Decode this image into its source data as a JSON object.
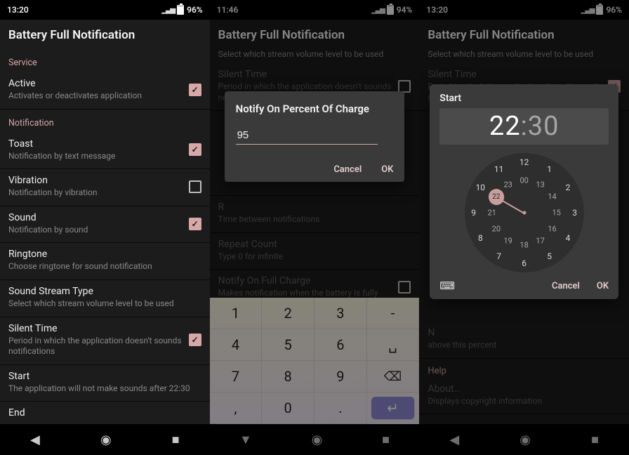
{
  "s1": {
    "time": "13:20",
    "batt": "96%",
    "title": "Battery Full Notification",
    "svc_label": "Service",
    "active": {
      "t": "Active",
      "s": "Activates or deactivates application"
    },
    "notif_label": "Notification",
    "toast": {
      "t": "Toast",
      "s": "Notification by text message"
    },
    "vibration": {
      "t": "Vibration",
      "s": "Notification by vibration"
    },
    "sound": {
      "t": "Sound",
      "s": "Notification by sound"
    },
    "ringtone": {
      "t": "Ringtone",
      "s": "Choose ringtone for sound notification"
    },
    "stream": {
      "t": "Sound Stream Type",
      "s": "Select which stream volume level to be used"
    },
    "silent": {
      "t": "Silent Time",
      "s": "Period in which the application doesn't sounds notifications"
    },
    "start": {
      "t": "Start",
      "s": "The application will not make sounds after 22:30"
    },
    "end": {
      "t": "End"
    }
  },
  "s2": {
    "time": "11:46",
    "batt": "94%",
    "title": "Battery Full Notification",
    "subtitle": "Select which stream volume level to be used",
    "silent": {
      "t": "Silent Time",
      "s": "Period in which the application doesn't sounds notifications"
    },
    "dialog_title": "Notify On Percent Of Charge",
    "dialog_value": "95",
    "cancel": "Cancel",
    "ok": "OK",
    "repeat_sub": "Time between notifications",
    "repeat_count": {
      "t": "Repeat Count",
      "s": "Type 0 for infinite"
    },
    "full": {
      "t": "Notify On Full Charge",
      "s": "Makes notification when the battery is fully"
    },
    "keys": [
      "1",
      "2",
      "3",
      "-",
      "4",
      "5",
      "6",
      "␣",
      "7",
      "8",
      "9",
      "⌫",
      ",",
      "0",
      ".",
      "↵"
    ]
  },
  "s3": {
    "time": "13:20",
    "batt": "96%",
    "title": "Battery Full Notification",
    "subtitle": "Select which stream volume level to be used",
    "silent": {
      "t": "Silent Time",
      "s": "Period in which the application doesn't sounds notifications"
    },
    "dialog_title": "Start",
    "hh": "22",
    "mm": "30",
    "cancel": "Cancel",
    "ok": "OK",
    "outer": [
      "12",
      "1",
      "2",
      "3",
      "4",
      "5",
      "6",
      "7",
      "8",
      "9",
      "10",
      "11"
    ],
    "inner": [
      "00",
      "13",
      "14",
      "15",
      "16",
      "17",
      "18",
      "19",
      "20",
      "21",
      "22",
      "23"
    ],
    "notify_above": "above this percent",
    "help": "Help",
    "about": {
      "t": "About…",
      "s": "Displays copyright information"
    }
  }
}
